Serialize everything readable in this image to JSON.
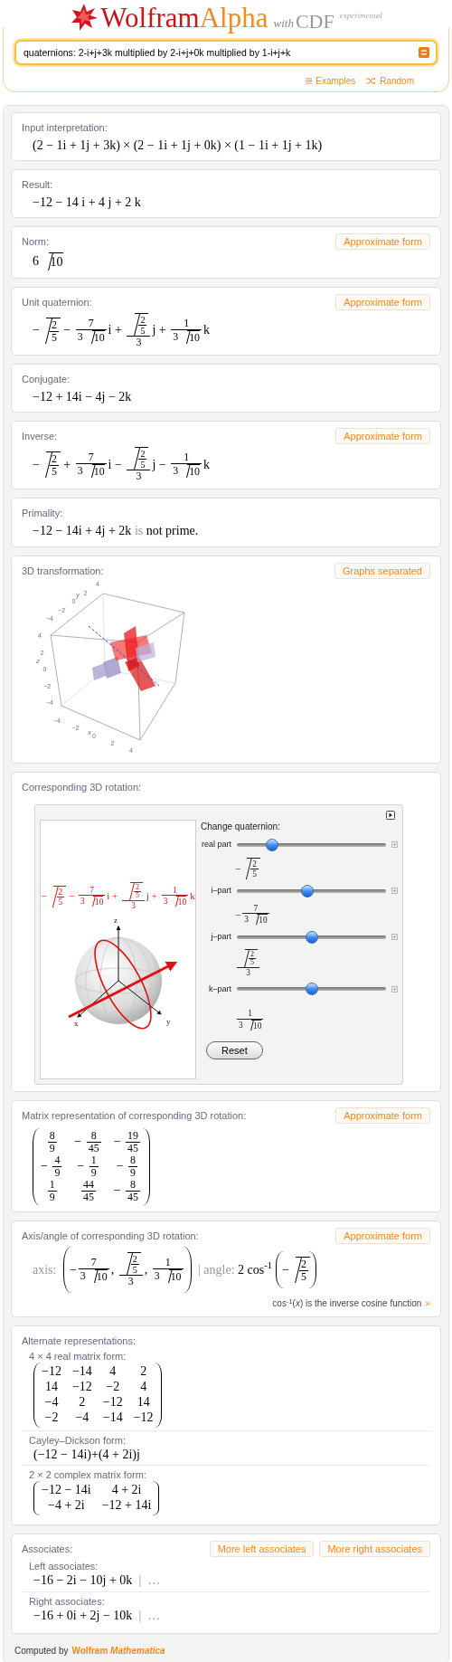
{
  "logo": {
    "word_1": "Wolfram",
    "word_2": "Alpha",
    "with": "with",
    "cdf": "CDF",
    "tag": "experimental"
  },
  "search": {
    "value": "quaternions: 2-i+j+3k multiplied by 2-i+j+0k multiplied by 1-i+j+k"
  },
  "links": [
    {
      "kind": "list",
      "label": "Examples"
    },
    {
      "kind": "shuffle",
      "label": "Random"
    }
  ],
  "pods": [
    {
      "kind": "math",
      "title": "Input interpretation:",
      "formula": [
        {
          "kind": "text",
          "text": "(2 − 1i + 1j + 3k) × (2 − 1i + 1j + 0k) × (1 − 1i + 1j + 1k)"
        }
      ]
    },
    {
      "kind": "math",
      "title": "Result:",
      "formula": [
        {
          "kind": "text",
          "text": "−12 − 14 i + 4 j + 2 k"
        }
      ]
    },
    {
      "kind": "math",
      "title": "Norm:",
      "buttons": [
        "Approximate form"
      ],
      "formula": [
        {
          "kind": "text",
          "text": "6 "
        },
        {
          "kind": "sqrt",
          "body": [
            {
              "kind": "text",
              "text": "10"
            }
          ]
        }
      ]
    },
    {
      "kind": "math",
      "title": "Unit quaternion:",
      "buttons": [
        "Approximate form"
      ],
      "formula": [
        {
          "kind": "text",
          "text": "−"
        },
        {
          "kind": "sqrt",
          "body": [
            {
              "kind": "frac",
              "num": [
                {
                  "kind": "text",
                  "text": "2"
                }
              ],
              "den": [
                {
                  "kind": "text",
                  "text": "5"
                }
              ]
            }
          ]
        },
        {
          "kind": "text",
          "text": " − "
        },
        {
          "kind": "frac",
          "num": [
            {
              "kind": "text",
              "text": "7"
            }
          ],
          "den": [
            {
              "kind": "text",
              "text": "3 "
            },
            {
              "kind": "sqrt",
              "body": [
                {
                  "kind": "text",
                  "text": "10"
                }
              ]
            }
          ]
        },
        {
          "kind": "text",
          "text": "i + "
        },
        {
          "kind": "frac",
          "num": [
            {
              "kind": "sqrt",
              "body": [
                {
                  "kind": "frac",
                  "num": [
                    {
                      "kind": "text",
                      "text": "2"
                    }
                  ],
                  "den": [
                    {
                      "kind": "text",
                      "text": "5"
                    }
                  ]
                }
              ]
            }
          ],
          "den": [
            {
              "kind": "text",
              "text": "3"
            }
          ]
        },
        {
          "kind": "text",
          "text": "j + "
        },
        {
          "kind": "frac",
          "num": [
            {
              "kind": "text",
              "text": "1"
            }
          ],
          "den": [
            {
              "kind": "text",
              "text": "3 "
            },
            {
              "kind": "sqrt",
              "body": [
                {
                  "kind": "text",
                  "text": "10"
                }
              ]
            }
          ]
        },
        {
          "kind": "text",
          "text": "k"
        }
      ]
    },
    {
      "kind": "math",
      "title": "Conjugate:",
      "formula": [
        {
          "kind": "text",
          "text": "−12 + 14i − 4j − 2k"
        }
      ]
    },
    {
      "kind": "math",
      "title": "Inverse:",
      "buttons": [
        "Approximate form"
      ],
      "formula": [
        {
          "kind": "text",
          "text": "−"
        },
        {
          "kind": "sqrt",
          "body": [
            {
              "kind": "frac",
              "num": [
                {
                  "kind": "text",
                  "text": "2"
                }
              ],
              "den": [
                {
                  "kind": "text",
                  "text": "5"
                }
              ]
            }
          ]
        },
        {
          "kind": "text",
          "text": " + "
        },
        {
          "kind": "frac",
          "num": [
            {
              "kind": "text",
              "text": "7"
            }
          ],
          "den": [
            {
              "kind": "text",
              "text": "3 "
            },
            {
              "kind": "sqrt",
              "body": [
                {
                  "kind": "text",
                  "text": "10"
                }
              ]
            }
          ]
        },
        {
          "kind": "text",
          "text": "i − "
        },
        {
          "kind": "frac",
          "num": [
            {
              "kind": "sqrt",
              "body": [
                {
                  "kind": "frac",
                  "num": [
                    {
                      "kind": "text",
                      "text": "2"
                    }
                  ],
                  "den": [
                    {
                      "kind": "text",
                      "text": "5"
                    }
                  ]
                }
              ]
            }
          ],
          "den": [
            {
              "kind": "text",
              "text": "3"
            }
          ]
        },
        {
          "kind": "text",
          "text": "j − "
        },
        {
          "kind": "frac",
          "num": [
            {
              "kind": "text",
              "text": "1"
            }
          ],
          "den": [
            {
              "kind": "text",
              "text": "3 "
            },
            {
              "kind": "sqrt",
              "body": [
                {
                  "kind": "text",
                  "text": "10"
                }
              ]
            }
          ]
        },
        {
          "kind": "text",
          "text": "k"
        }
      ]
    },
    {
      "kind": "math",
      "title": "Primality:",
      "formula": [
        {
          "kind": "text",
          "text": "−12 − 14i + 4j + 2k "
        },
        {
          "kind": "muted",
          "text": "is"
        },
        {
          "kind": "text",
          "text": " not prime."
        }
      ]
    },
    {
      "kind": "plot3d",
      "title": "3D transformation:",
      "buttons": [
        "Graphs separated"
      ],
      "axes": [
        {
          "label": "y",
          "ticks": [
            "4",
            "2",
            "0",
            "−2",
            "−4"
          ]
        },
        {
          "label": "z",
          "ticks": [
            "4",
            "2",
            "0",
            "−2",
            "−4"
          ]
        },
        {
          "label": "x",
          "ticks": [
            "−4",
            "−2",
            "0",
            "2",
            "4"
          ]
        }
      ]
    },
    {
      "kind": "manipulate",
      "title": "Corresponding 3D rotation:",
      "formula": [
        {
          "kind": "text",
          "text": "−"
        },
        {
          "kind": "sqrt",
          "body": [
            {
              "kind": "frac",
              "num": [
                {
                  "kind": "text",
                  "text": "2"
                }
              ],
              "den": [
                {
                  "kind": "text",
                  "text": "5"
                }
              ]
            }
          ]
        },
        {
          "kind": "text",
          "text": " − "
        },
        {
          "kind": "frac",
          "num": [
            {
              "kind": "text",
              "text": "7"
            }
          ],
          "den": [
            {
              "kind": "text",
              "text": "3 "
            },
            {
              "kind": "sqrt",
              "body": [
                {
                  "kind": "text",
                  "text": "10"
                }
              ]
            }
          ]
        },
        {
          "kind": "text",
          "text": "i + "
        },
        {
          "kind": "frac",
          "num": [
            {
              "kind": "sqrt",
              "body": [
                {
                  "kind": "frac",
                  "num": [
                    {
                      "kind": "text",
                      "text": "2"
                    }
                  ],
                  "den": [
                    {
                      "kind": "text",
                      "text": "5"
                    }
                  ]
                }
              ]
            }
          ],
          "den": [
            {
              "kind": "text",
              "text": "3"
            }
          ]
        },
        {
          "kind": "text",
          "text": "j + "
        },
        {
          "kind": "frac",
          "num": [
            {
              "kind": "text",
              "text": "1"
            }
          ],
          "den": [
            {
              "kind": "text",
              "text": "3 "
            },
            {
              "kind": "sqrt",
              "body": [
                {
                  "kind": "text",
                  "text": "10"
                }
              ]
            }
          ]
        },
        {
          "kind": "text",
          "text": "k"
        }
      ],
      "axis_labels": [
        "x",
        "y",
        "z"
      ],
      "controls_title": "Change quaternion:",
      "sliders": [
        {
          "label": "real part",
          "level": 0.21,
          "value": [
            {
              "kind": "text",
              "text": "−"
            },
            {
              "kind": "sqrt",
              "body": [
                {
                  "kind": "frac",
                  "num": [
                    {
                      "kind": "text",
                      "text": "2"
                    }
                  ],
                  "den": [
                    {
                      "kind": "text",
                      "text": "5"
                    }
                  ]
                }
              ]
            }
          ]
        },
        {
          "label": "i–part",
          "level": 0.47,
          "value": [
            {
              "kind": "text",
              "text": "−"
            },
            {
              "kind": "frac",
              "num": [
                {
                  "kind": "text",
                  "text": "7"
                }
              ],
              "den": [
                {
                  "kind": "text",
                  "text": "3 "
                },
                {
                  "kind": "sqrt",
                  "body": [
                    {
                      "kind": "text",
                      "text": "10"
                    }
                  ]
                }
              ]
            }
          ]
        },
        {
          "label": "j–part",
          "level": 0.5,
          "value": [
            {
              "kind": "frac",
              "num": [
                {
                  "kind": "sqrt",
                  "body": [
                    {
                      "kind": "frac",
                      "num": [
                        {
                          "kind": "text",
                          "text": "2"
                        }
                      ],
                      "den": [
                        {
                          "kind": "text",
                          "text": "5"
                        }
                      ]
                    }
                  ]
                }
              ],
              "den": [
                {
                  "kind": "text",
                  "text": "3"
                }
              ]
            }
          ]
        },
        {
          "label": "k–part",
          "level": 0.5,
          "value": [
            {
              "kind": "frac",
              "num": [
                {
                  "kind": "text",
                  "text": "1"
                }
              ],
              "den": [
                {
                  "kind": "text",
                  "text": "3 "
                },
                {
                  "kind": "sqrt",
                  "body": [
                    {
                      "kind": "text",
                      "text": "10"
                    }
                  ]
                }
              ]
            }
          ]
        }
      ],
      "reset": "Reset"
    },
    {
      "kind": "math",
      "title": "Matrix representation of corresponding 3D rotation:",
      "buttons": [
        "Approximate form"
      ],
      "formula": [
        {
          "kind": "matrix",
          "rows": [
            [
              [
                {
                  "kind": "frac",
                  "num": [
                    {
                      "kind": "text",
                      "text": "8"
                    }
                  ],
                  "den": [
                    {
                      "kind": "text",
                      "text": "9"
                    }
                  ]
                }
              ],
              [
                {
                  "kind": "text",
                  "text": "− "
                },
                {
                  "kind": "frac",
                  "num": [
                    {
                      "kind": "text",
                      "text": "8"
                    }
                  ],
                  "den": [
                    {
                      "kind": "text",
                      "text": "45"
                    }
                  ]
                }
              ],
              [
                {
                  "kind": "text",
                  "text": "− "
                },
                {
                  "kind": "frac",
                  "num": [
                    {
                      "kind": "text",
                      "text": "19"
                    }
                  ],
                  "den": [
                    {
                      "kind": "text",
                      "text": "45"
                    }
                  ]
                }
              ]
            ],
            [
              [
                {
                  "kind": "text",
                  "text": "− "
                },
                {
                  "kind": "frac",
                  "num": [
                    {
                      "kind": "text",
                      "text": "4"
                    }
                  ],
                  "den": [
                    {
                      "kind": "text",
                      "text": "9"
                    }
                  ]
                }
              ],
              [
                {
                  "kind": "text",
                  "text": "− "
                },
                {
                  "kind": "frac",
                  "num": [
                    {
                      "kind": "text",
                      "text": "1"
                    }
                  ],
                  "den": [
                    {
                      "kind": "text",
                      "text": "9"
                    }
                  ]
                }
              ],
              [
                {
                  "kind": "text",
                  "text": "− "
                },
                {
                  "kind": "frac",
                  "num": [
                    {
                      "kind": "text",
                      "text": "8"
                    }
                  ],
                  "den": [
                    {
                      "kind": "text",
                      "text": "9"
                    }
                  ]
                }
              ]
            ],
            [
              [
                {
                  "kind": "frac",
                  "num": [
                    {
                      "kind": "text",
                      "text": "1"
                    }
                  ],
                  "den": [
                    {
                      "kind": "text",
                      "text": "9"
                    }
                  ]
                }
              ],
              [
                {
                  "kind": "frac",
                  "num": [
                    {
                      "kind": "text",
                      "text": "44"
                    }
                  ],
                  "den": [
                    {
                      "kind": "text",
                      "text": "45"
                    }
                  ]
                }
              ],
              [
                {
                  "kind": "text",
                  "text": "− "
                },
                {
                  "kind": "frac",
                  "num": [
                    {
                      "kind": "text",
                      "text": "8"
                    }
                  ],
                  "den": [
                    {
                      "kind": "text",
                      "text": "45"
                    }
                  ]
                }
              ]
            ]
          ]
        }
      ]
    },
    {
      "kind": "math",
      "title": "Axis/angle of corresponding 3D rotation:",
      "buttons": [
        "Approximate form"
      ],
      "formula": [
        {
          "kind": "muted",
          "text": "axis: "
        },
        {
          "kind": "paren",
          "body": [
            {
              "kind": "text",
              "text": "−"
            },
            {
              "kind": "frac",
              "num": [
                {
                  "kind": "text",
                  "text": "7"
                }
              ],
              "den": [
                {
                  "kind": "text",
                  "text": "3 "
                },
                {
                  "kind": "sqrt",
                  "body": [
                    {
                      "kind": "text",
                      "text": "10"
                    }
                  ]
                }
              ]
            },
            {
              "kind": "text",
              "text": ", "
            },
            {
              "kind": "frac",
              "num": [
                {
                  "kind": "sqrt",
                  "body": [
                    {
                      "kind": "frac",
                      "num": [
                        {
                          "kind": "text",
                          "text": "2"
                        }
                      ],
                      "den": [
                        {
                          "kind": "text",
                          "text": "5"
                        }
                      ]
                    }
                  ]
                }
              ],
              "den": [
                {
                  "kind": "text",
                  "text": "3"
                }
              ]
            },
            {
              "kind": "text",
              "text": ", "
            },
            {
              "kind": "frac",
              "num": [
                {
                  "kind": "text",
                  "text": "1"
                }
              ],
              "den": [
                {
                  "kind": "text",
                  "text": "3 "
                },
                {
                  "kind": "sqrt",
                  "body": [
                    {
                      "kind": "text",
                      "text": "10"
                    }
                  ]
                }
              ]
            }
          ]
        },
        {
          "kind": "muted",
          "text": " | angle: "
        },
        {
          "kind": "text",
          "text": "2 cos$^{-1}$"
        },
        {
          "kind": "paren",
          "body": [
            {
              "kind": "text",
              "text": "−"
            },
            {
              "kind": "sqrt",
              "body": [
                {
                  "kind": "frac",
                  "num": [
                    {
                      "kind": "text",
                      "text": "2"
                    }
                  ],
                  "den": [
                    {
                      "kind": "text",
                      "text": "5"
                    }
                  ]
                }
              ]
            }
          ]
        }
      ],
      "note": {
        "text": "cos$^{-1}$(*x*) is the inverse cosine function",
        "link": "»"
      }
    },
    {
      "kind": "sections",
      "title": "Alternate representations:",
      "sections": [
        {
          "title": "4 × 4 real matrix form:",
          "formula": [
            {
              "kind": "matrix",
              "rows": [
                [
                  [
                    {
                      "kind": "text",
                      "text": "−12"
                    }
                  ],
                  [
                    {
                      "kind": "text",
                      "text": "−14"
                    }
                  ],
                  [
                    {
                      "kind": "text",
                      "text": "4"
                    }
                  ],
                  [
                    {
                      "kind": "text",
                      "text": "2"
                    }
                  ]
                ],
                [
                  [
                    {
                      "kind": "text",
                      "text": "14"
                    }
                  ],
                  [
                    {
                      "kind": "text",
                      "text": "−12"
                    }
                  ],
                  [
                    {
                      "kind": "text",
                      "text": "−2"
                    }
                  ],
                  [
                    {
                      "kind": "text",
                      "text": "4"
                    }
                  ]
                ],
                [
                  [
                    {
                      "kind": "text",
                      "text": "−4"
                    }
                  ],
                  [
                    {
                      "kind": "text",
                      "text": "2"
                    }
                  ],
                  [
                    {
                      "kind": "text",
                      "text": "−12"
                    }
                  ],
                  [
                    {
                      "kind": "text",
                      "text": "14"
                    }
                  ]
                ],
                [
                  [
                    {
                      "kind": "text",
                      "text": "−2"
                    }
                  ],
                  [
                    {
                      "kind": "text",
                      "text": "−4"
                    }
                  ],
                  [
                    {
                      "kind": "text",
                      "text": "−14"
                    }
                  ],
                  [
                    {
                      "kind": "text",
                      "text": "−12"
                    }
                  ]
                ]
              ]
            }
          ]
        },
        {
          "title": "Cayley–Dickson form:",
          "formula": [
            {
              "kind": "text",
              "text": "(−12 − 14i)+(4 + 2i)j"
            }
          ]
        },
        {
          "title": "2 × 2 complex matrix form:",
          "formula": [
            {
              "kind": "matrix",
              "rows": [
                [
                  [
                    {
                      "kind": "text",
                      "text": "−12 − 14i"
                    }
                  ],
                  [
                    {
                      "kind": "text",
                      "text": "4 + 2i"
                    }
                  ]
                ],
                [
                  [
                    {
                      "kind": "text",
                      "text": "−4 + 2i"
                    }
                  ],
                  [
                    {
                      "kind": "text",
                      "text": "−12 + 14i"
                    }
                  ]
                ]
              ]
            }
          ]
        }
      ]
    },
    {
      "kind": "sections",
      "title": "Associates:",
      "buttons": [
        "More left associates",
        "More right associates"
      ],
      "sections": [
        {
          "title": "Left associates:",
          "formula": [
            {
              "kind": "text",
              "text": "−16 − 2i − 10j + 0k"
            },
            {
              "kind": "muted",
              "text": "  |  …"
            }
          ]
        },
        {
          "title": "Right associates:",
          "formula": [
            {
              "kind": "text",
              "text": "−16 + 0i + 2j − 10k"
            },
            {
              "kind": "muted",
              "text": "  |  …"
            }
          ]
        }
      ]
    }
  ],
  "footer": {
    "prefix": "Computed by",
    "link": "Wolfram *Mathematica*"
  }
}
